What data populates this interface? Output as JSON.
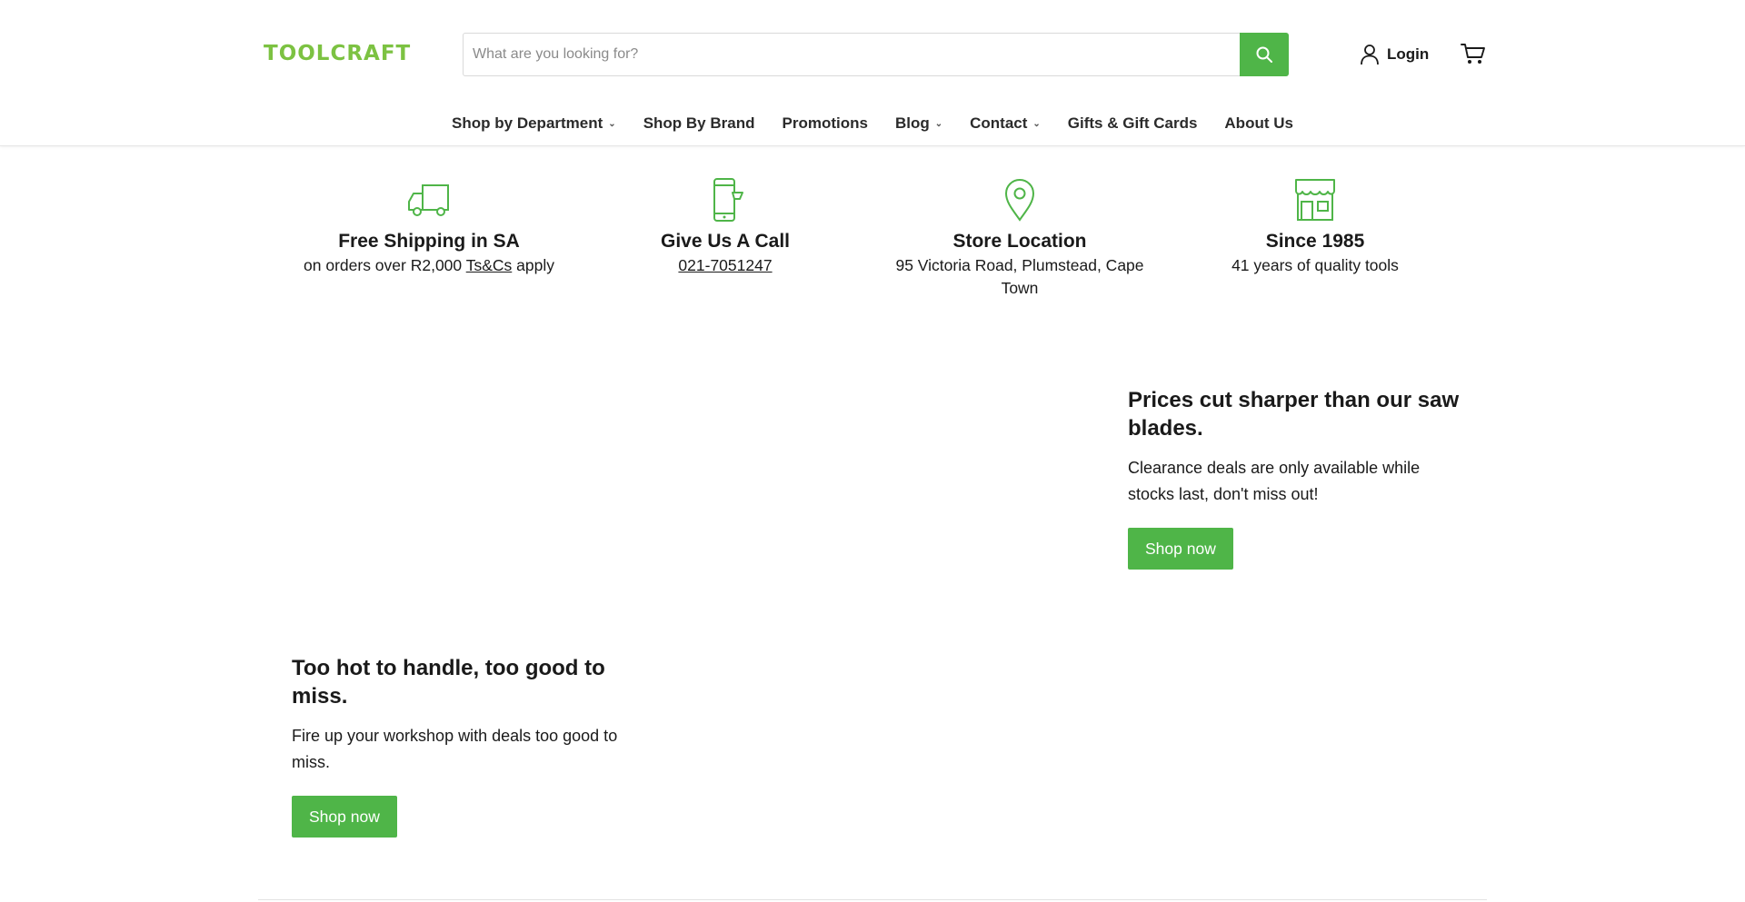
{
  "brand": {
    "logo_text": "TOOLCRAFT",
    "accent_color": "#4fb548",
    "logo_color": "#7cc242"
  },
  "search": {
    "placeholder": "What are you looking for?",
    "value": "",
    "button_icon": "search-icon"
  },
  "header": {
    "login_label": "Login",
    "login_icon": "user-icon",
    "cart_icon": "cart-icon"
  },
  "nav": {
    "items": [
      {
        "label": "Shop by Department",
        "dropdown": true
      },
      {
        "label": "Shop By Brand",
        "dropdown": false
      },
      {
        "label": "Promotions",
        "dropdown": false
      },
      {
        "label": "Blog",
        "dropdown": true
      },
      {
        "label": "Contact",
        "dropdown": true
      },
      {
        "label": "Gifts & Gift Cards",
        "dropdown": false
      },
      {
        "label": "About Us",
        "dropdown": false
      }
    ]
  },
  "features": [
    {
      "icon": "truck-icon",
      "title": "Free Shipping in SA",
      "desc_before": "on orders over R2,000 ",
      "link": "Ts&Cs",
      "desc_after": " apply"
    },
    {
      "icon": "phone-icon",
      "title": "Give Us A Call",
      "link": " 021-7051247"
    },
    {
      "icon": "map-pin-icon",
      "title": "Store Location",
      "desc": "95 Victoria Road, Plumstead, Cape Town"
    },
    {
      "icon": "storefront-icon",
      "title": "Since 1985",
      "desc": "41 years of quality tools"
    }
  ],
  "promos": [
    {
      "title": "Prices cut sharper than our saw blades.",
      "desc": "Clearance deals are only available while stocks last, don't miss out!",
      "button": "Shop now"
    },
    {
      "title": "Too hot to handle, too good to miss.",
      "desc": "Fire up your workshop with deals too good to miss.",
      "button": "Shop now"
    }
  ]
}
